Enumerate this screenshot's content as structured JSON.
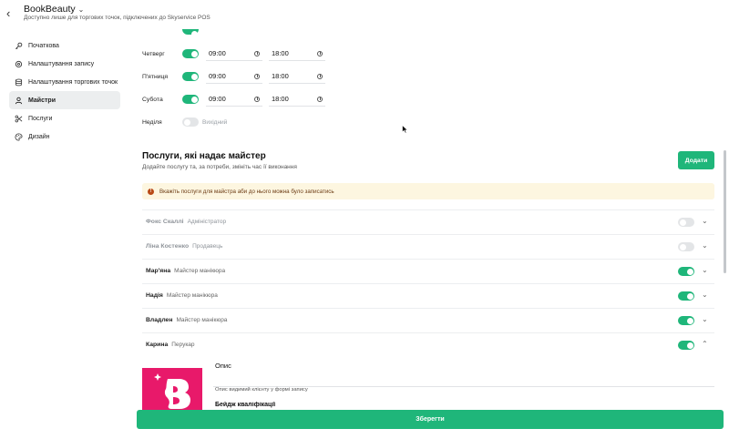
{
  "header": {
    "title": "BookBeauty",
    "subtitle": "Доступно лише для торгових точок, підключених до Skyservice POS"
  },
  "sidebar": {
    "items": [
      {
        "label": "Початкова",
        "icon": "key-icon"
      },
      {
        "label": "Налаштування запису",
        "icon": "gear-icon"
      },
      {
        "label": "Налаштування торгових точок",
        "icon": "database-icon"
      },
      {
        "label": "Майстри",
        "icon": "user-icon",
        "active": true
      },
      {
        "label": "Послуги",
        "icon": "scissors-icon"
      },
      {
        "label": "Дизайн",
        "icon": "palette-icon"
      }
    ]
  },
  "schedule": {
    "days": [
      {
        "name": "Четверг",
        "enabled": true,
        "from": "09:00",
        "to": "18:00"
      },
      {
        "name": "П'ятниця",
        "enabled": true,
        "from": "09:00",
        "to": "18:00"
      },
      {
        "name": "Субота",
        "enabled": true,
        "from": "09:00",
        "to": "18:00"
      },
      {
        "name": "Неділя",
        "enabled": false,
        "status": "Вихідний"
      }
    ]
  },
  "services_section": {
    "title": "Послуги, які надає майстер",
    "subtitle": "Додайте послугу та, за потреби, змініть час її виконання",
    "add_label": "Додати",
    "warning": "Вкажіть послуги для майстра аби до нього можна було записатись"
  },
  "staff": [
    {
      "name": "Фокс Скаллі",
      "role": "Адміністратор",
      "enabled": false
    },
    {
      "name": "Ліна Костенко",
      "role": "Продавець",
      "enabled": false
    },
    {
      "name": "Мар'яна",
      "role": "Майстер манікюра",
      "enabled": true
    },
    {
      "name": "Надія",
      "role": "Майстер манікюра",
      "enabled": true
    },
    {
      "name": "Владлен",
      "role": "Майстер манікюра",
      "enabled": true
    },
    {
      "name": "Карина",
      "role": "Перукар",
      "enabled": true,
      "expanded": true
    }
  ],
  "detail": {
    "description_label": "Опис",
    "description_value": "",
    "description_hint": "Опис видимий клієнту у формі запису",
    "qualification_label": "Бейдж кваліфікації"
  },
  "footer": {
    "save_label": "Зберегти"
  },
  "colors": {
    "accent": "#1fb67a",
    "warning_bg": "#fdf6e0",
    "warning_icon": "#b84a16",
    "photo_bg": "#e8196a"
  }
}
